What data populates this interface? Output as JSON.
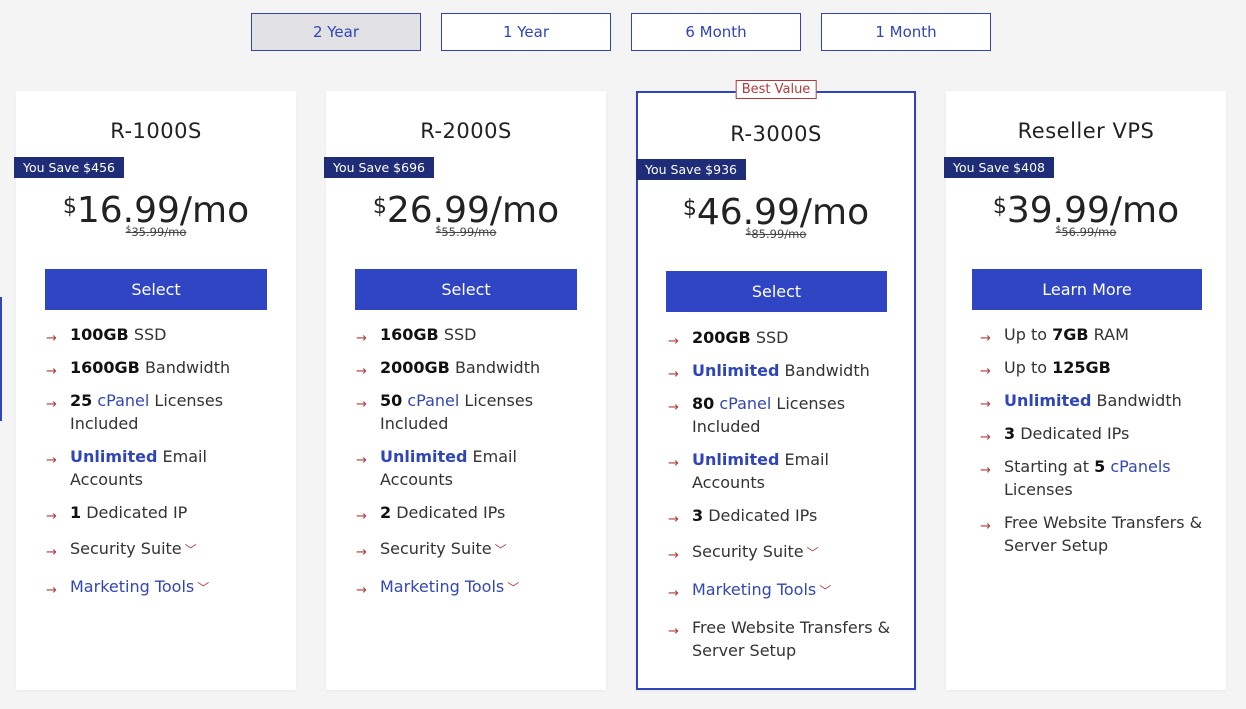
{
  "billing_tabs": [
    {
      "label": "2 Year",
      "active": true
    },
    {
      "label": "1 Year",
      "active": false
    },
    {
      "label": "6 Month",
      "active": false
    },
    {
      "label": "1 Month",
      "active": false
    }
  ],
  "plans": [
    {
      "name": "R-1000S",
      "save": "You Save $456",
      "currency": "$",
      "price": "16.99/mo",
      "orig_price": "35.99/mo",
      "button": "Select",
      "f1_bold": "100GB",
      "f1_text": " SSD",
      "f2_bold": "1600GB",
      "f2_text": " Bandwidth",
      "f3_bold": "25",
      "f3_link": "cPanel",
      "f3_text": " Licenses Included",
      "f4_bold": "Unlimited",
      "f4_text": " Email Accounts",
      "f5_bold": "1",
      "f5_text": " Dedicated IP",
      "f6_text": "Security Suite",
      "f7_text": "Marketing Tools"
    },
    {
      "name": "R-2000S",
      "save": "You Save $696",
      "currency": "$",
      "price": "26.99/mo",
      "orig_price": "55.99/mo",
      "button": "Select",
      "f1_bold": "160GB",
      "f1_text": " SSD",
      "f2_bold": "2000GB",
      "f2_text": " Bandwidth",
      "f3_bold": "50",
      "f3_link": "cPanel",
      "f3_text": " Licenses Included",
      "f4_bold": "Unlimited",
      "f4_text": " Email Accounts",
      "f5_bold": "2",
      "f5_text": " Dedicated IPs",
      "f6_text": "Security Suite",
      "f7_text": "Marketing Tools"
    },
    {
      "name": "R-3000S",
      "badge": "Best Value",
      "save": "You Save $936",
      "currency": "$",
      "price": "46.99/mo",
      "orig_price": "85.99/mo",
      "button": "Select",
      "f1_bold": "200GB",
      "f1_text": " SSD",
      "f2_bold": "Unlimited",
      "f2_text": " Bandwidth",
      "f3_bold": "80",
      "f3_link": "cPanel",
      "f3_text": " Licenses Included",
      "f4_bold": "Unlimited",
      "f4_text": " Email Accounts",
      "f5_bold": "3",
      "f5_text": " Dedicated IPs",
      "f6_text": "Security Suite",
      "f7_text": "Marketing Tools",
      "f8_text": "Free Website Transfers & Server Setup"
    },
    {
      "name": "Reseller VPS",
      "save": "You Save $408",
      "currency": "$",
      "price": "39.99/mo",
      "orig_price": "56.99/mo",
      "button": "Learn More",
      "f1_pre": "Up to ",
      "f1_bold": "7GB",
      "f1_text": " RAM",
      "f2_pre": "Up to ",
      "f2_bold": "125GB",
      "f3_bold": "Unlimited",
      "f3_text": " Bandwidth",
      "f4_bold": "3",
      "f4_text": " Dedicated IPs",
      "f5_pre": "Starting at ",
      "f5_bold": "5",
      "f5_link": "cPanels",
      "f5_text": " Licenses",
      "f6_text": "Free Website Transfers & Server Setup"
    }
  ],
  "colors": {
    "accent": "#2f45c4",
    "badge": "#1f2d78",
    "arrow": "#b23a3a"
  },
  "icons": {
    "feature_bullet": "arrow-right-icon",
    "expand": "chevron-down-icon"
  }
}
